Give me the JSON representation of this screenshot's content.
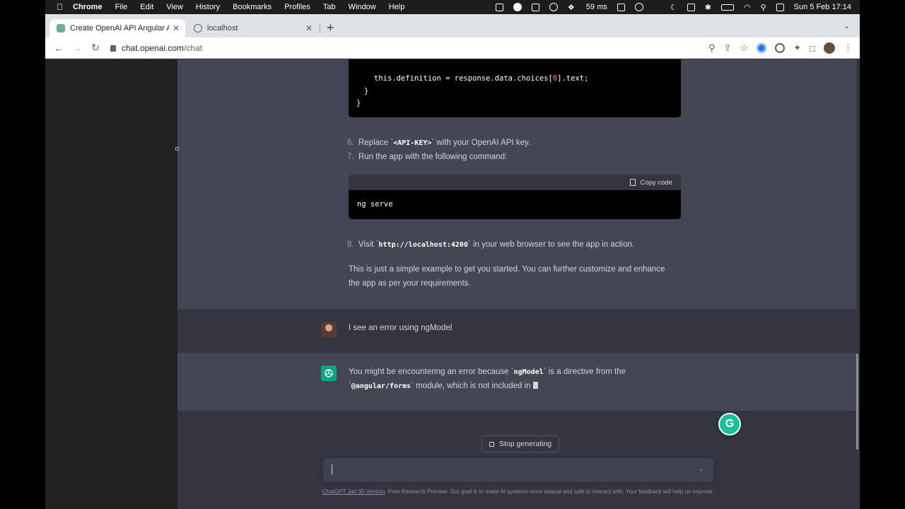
{
  "menubar": {
    "app": "Chrome",
    "items": [
      "File",
      "Edit",
      "View",
      "History",
      "Bookmarks",
      "Profiles",
      "Tab",
      "Window",
      "Help"
    ],
    "latency": "59 ms",
    "clock": "Sun 5 Feb  17:14"
  },
  "tabs": [
    {
      "title": "Create OpenAI API Angular Ap",
      "icon": "chatgpt-icon"
    },
    {
      "title": "localhost",
      "icon": "globe-icon"
    }
  ],
  "address": {
    "host": "chat.openai.com",
    "path": "/chat"
  },
  "code1": {
    "line1_a": "this.definition = response.data.choices[",
    "line1_idx": "0",
    "line1_b": "].text;",
    "line2": "}",
    "line3": "}"
  },
  "steps": {
    "s6_num": "6.",
    "s6_pre": "Replace `",
    "s6_code": "<API-KEY>",
    "s6_post": "` with your OpenAI API key.",
    "s7_num": "7.",
    "s7_text": "Run the app with the following command:",
    "s8_num": "8.",
    "s8_pre": "Visit `",
    "s8_code": "http://localhost:4200",
    "s8_post": "` in your web browser to see the app in action."
  },
  "code2": {
    "copy_label": "Copy code",
    "command": "ng serve"
  },
  "summary": {
    "line1": "This is just a simple example to get you started. You can further customize and enhance",
    "line2": "the app as per your requirements."
  },
  "user_message": "I see an error using ngModel",
  "assistant_reply": {
    "l1_pre": "You might be encountering an error because `",
    "l1_code": "ngModel",
    "l1_post": "` is a directive from the",
    "l2_pre": "`",
    "l2_code": "@angular/forms",
    "l2_post": "` module, which is not included in "
  },
  "stop_button": "Stop generating",
  "footer": {
    "link": "ChatGPT Jan 30 Version",
    "text": ". Free Research Preview. Our goal is to make AI systems more natural and safe to interact with. Your feedback will help us improve."
  },
  "colors": {
    "sidebar": "#202123",
    "assistant_bg": "#444654",
    "user_bg": "#343541",
    "accent": "#10a37f",
    "grammarly": "#15c39a"
  }
}
